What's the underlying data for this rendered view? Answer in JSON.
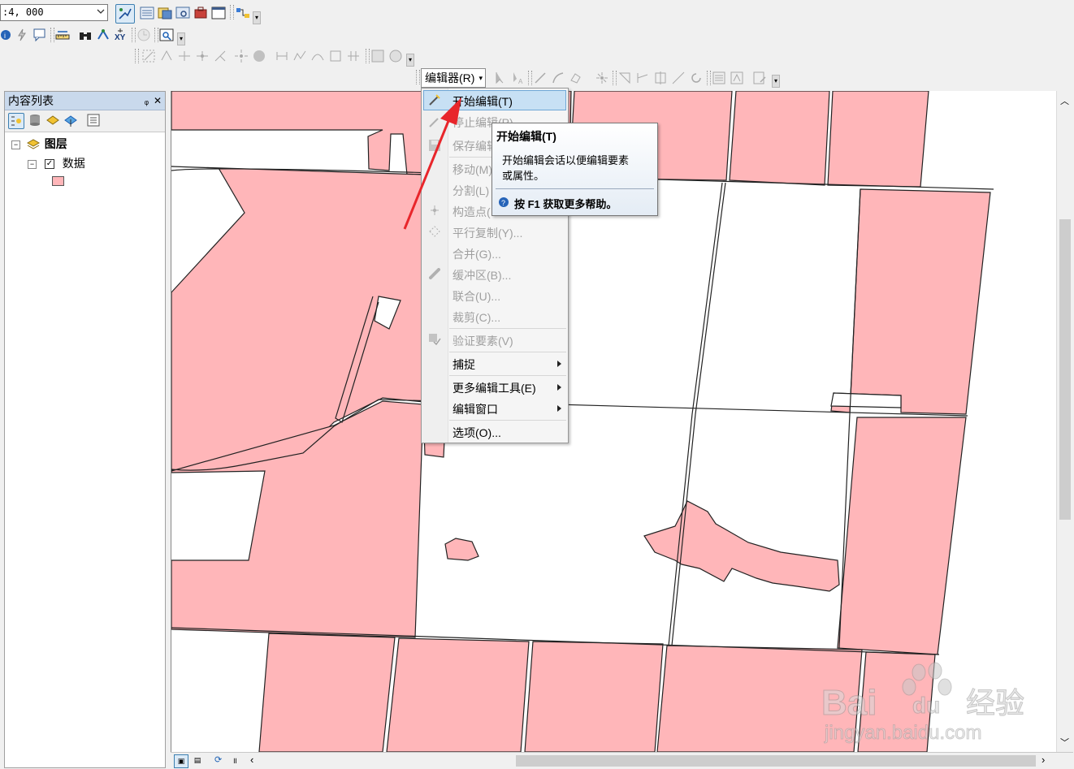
{
  "toolbar": {
    "scale_value": ":4, 000"
  },
  "toc": {
    "title": "内容列表",
    "pin": "ᵩ",
    "close": "✕",
    "layers_label": "图层",
    "data_label": "数据",
    "symbol_color": "#ffb6b9"
  },
  "editor": {
    "button_label": "编辑器(R)",
    "menu_items": [
      {
        "label": "开始编辑(T)",
        "enabled": true
      },
      {
        "label": "停止编辑(P)",
        "enabled": false
      },
      {
        "label": "保存编辑",
        "enabled": false
      },
      {
        "label": "移动(M)",
        "enabled": false
      },
      {
        "label": "分割(L)",
        "enabled": false
      },
      {
        "label": "构造点(",
        "enabled": false
      },
      {
        "label": "平行复制(Y)...",
        "enabled": false
      },
      {
        "label": "合并(G)...",
        "enabled": false
      },
      {
        "label": "缓冲区(B)...",
        "enabled": false
      },
      {
        "label": "联合(U)...",
        "enabled": false
      },
      {
        "label": "裁剪(C)...",
        "enabled": false
      },
      {
        "label": "验证要素(V)",
        "enabled": false
      },
      {
        "label": "捕捉",
        "enabled": true
      },
      {
        "label": "更多编辑工具(E)",
        "enabled": true
      },
      {
        "label": "编辑窗口",
        "enabled": true
      },
      {
        "label": "选项(O)...",
        "enabled": true
      }
    ]
  },
  "tooltip": {
    "title": "开始编辑(T)",
    "body_line1": "开始编辑会话以便编辑要素",
    "body_line2": "或属性。",
    "help": "按 F1 获取更多帮助。"
  },
  "watermark": {
    "brand": "Bai",
    "brand2": "du",
    "cn": "经验",
    "url": "jingyan.baidu.com"
  },
  "colors": {
    "parcel_fill": "#ffb6b9",
    "arrow": "#e8262b",
    "selection": "#c7e0f4"
  }
}
